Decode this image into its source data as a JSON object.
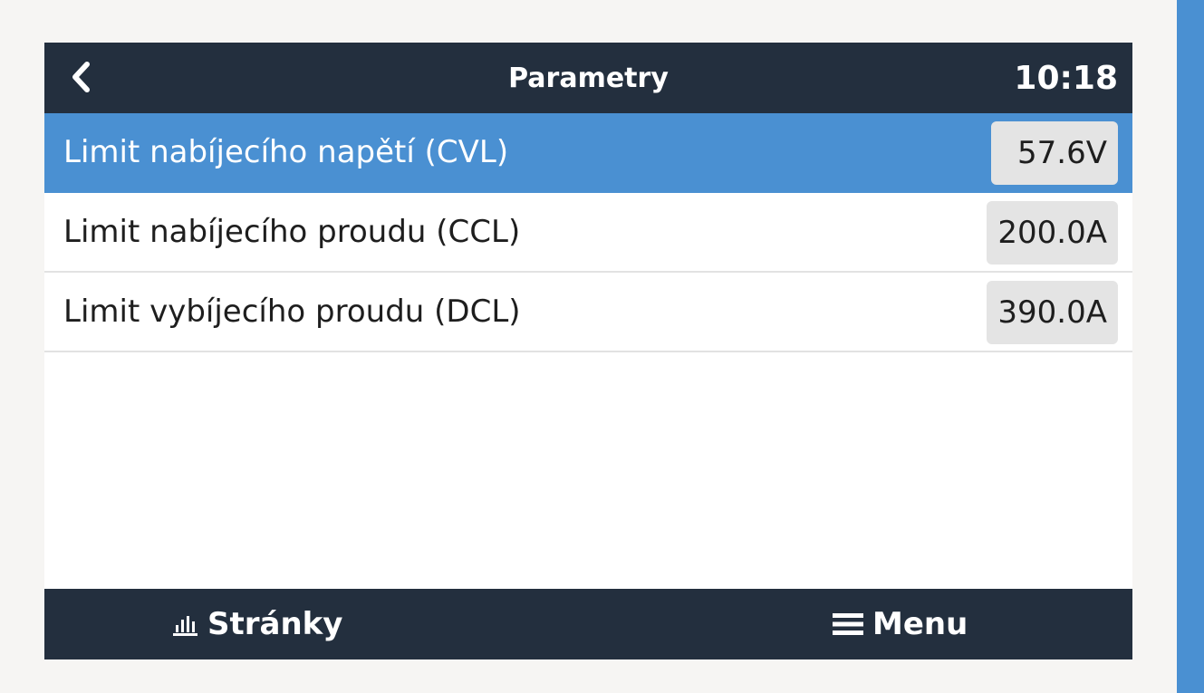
{
  "header": {
    "title": "Parametry",
    "time": "10:18",
    "back_icon": "chevron-left-icon"
  },
  "rows": [
    {
      "label": "Limit nabíjecího napětí (CVL)",
      "value": "57.6V",
      "selected": true
    },
    {
      "label": "Limit nabíjecího proudu (CCL)",
      "value": "200.0A",
      "selected": false
    },
    {
      "label": "Limit vybíjecího proudu (DCL)",
      "value": "390.0A",
      "selected": false
    }
  ],
  "footer": {
    "pages_label": "Stránky",
    "pages_icon": "bar-chart-icon",
    "menu_label": "Menu",
    "menu_icon": "hamburger-icon"
  },
  "colors": {
    "header_bg": "#232f3e",
    "accent": "#4a90d2",
    "value_box": "#e4e4e4",
    "background": "#f6f5f3"
  }
}
